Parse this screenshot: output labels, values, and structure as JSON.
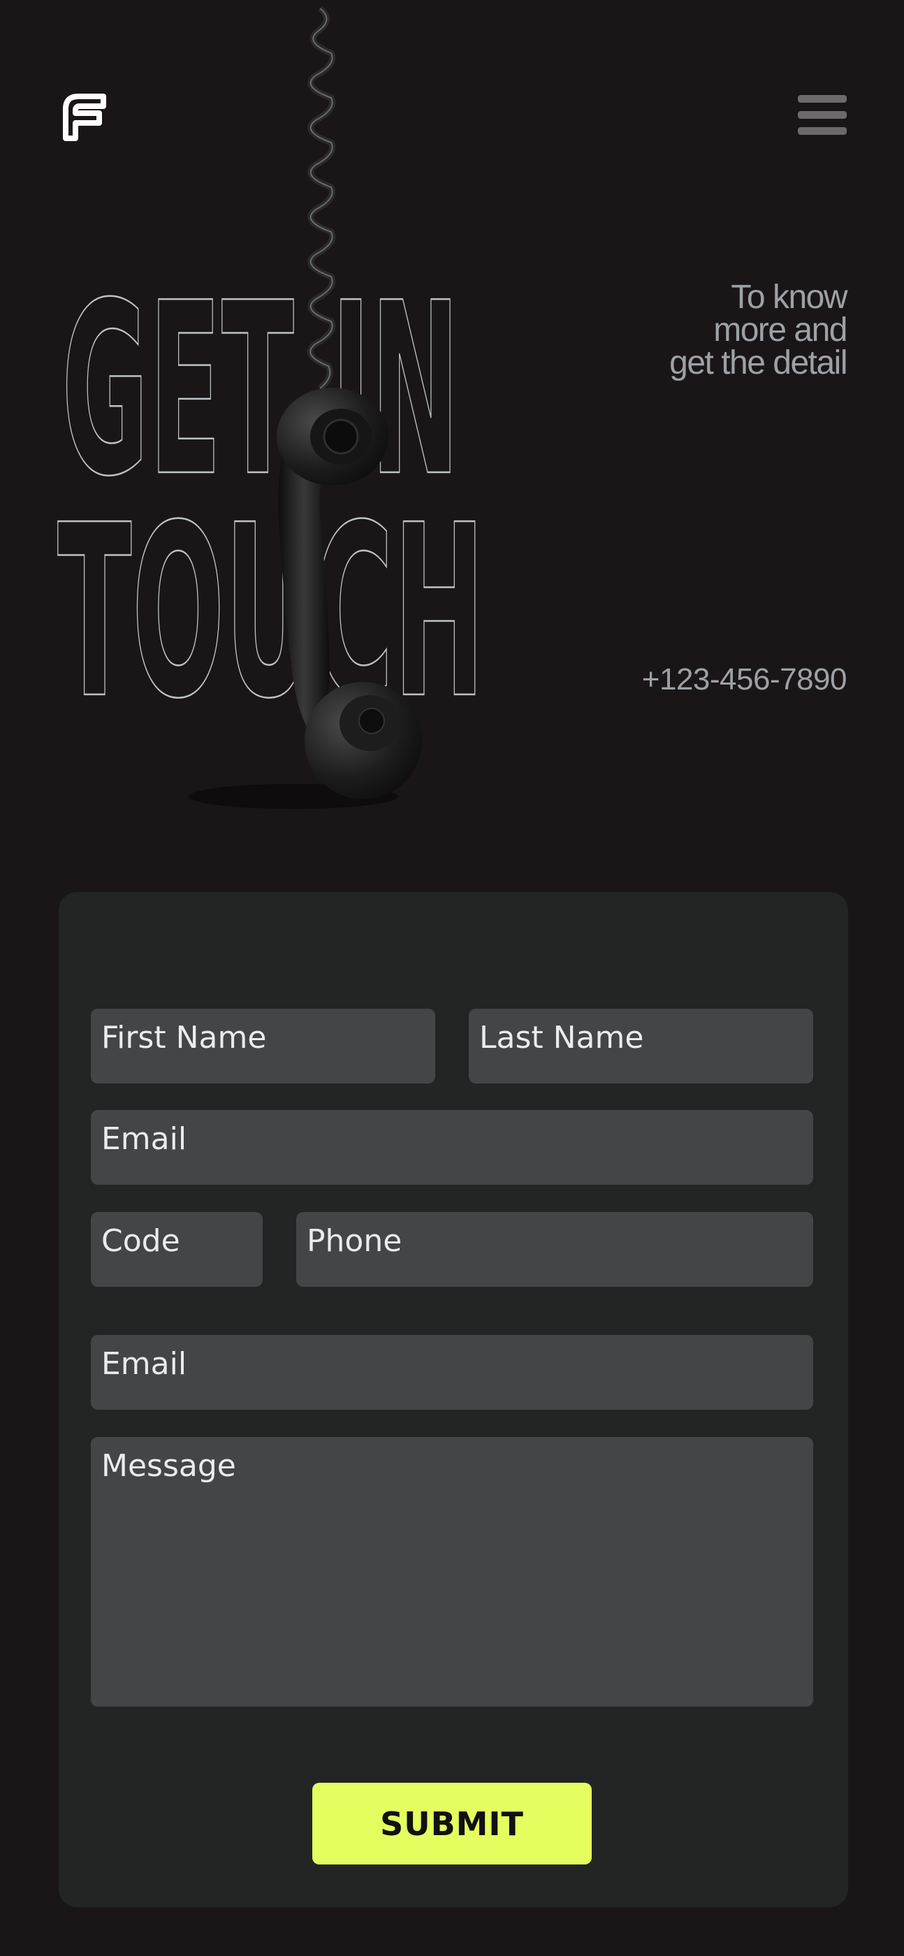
{
  "header": {
    "logo_icon": "stylized-f-logo",
    "menu_icon": "hamburger-menu-icon"
  },
  "hero": {
    "title_line1": "GET IN",
    "title_line2": "TOUCH",
    "tagline": "To know more and get the detail",
    "phone": "+123-456-7890",
    "image": "hanging-telephone-receiver"
  },
  "form": {
    "first_name_placeholder": "First Name",
    "last_name_placeholder": "Last Name",
    "email_placeholder": "Email",
    "code_placeholder": "Code",
    "phone_placeholder": "Phone",
    "email2_placeholder": "Email",
    "message_placeholder": "Message",
    "submit_label": "SUBMIT"
  },
  "colors": {
    "background": "#1a1617",
    "card": "#232424",
    "field": "#434647",
    "accent": "#e4fd5f"
  }
}
